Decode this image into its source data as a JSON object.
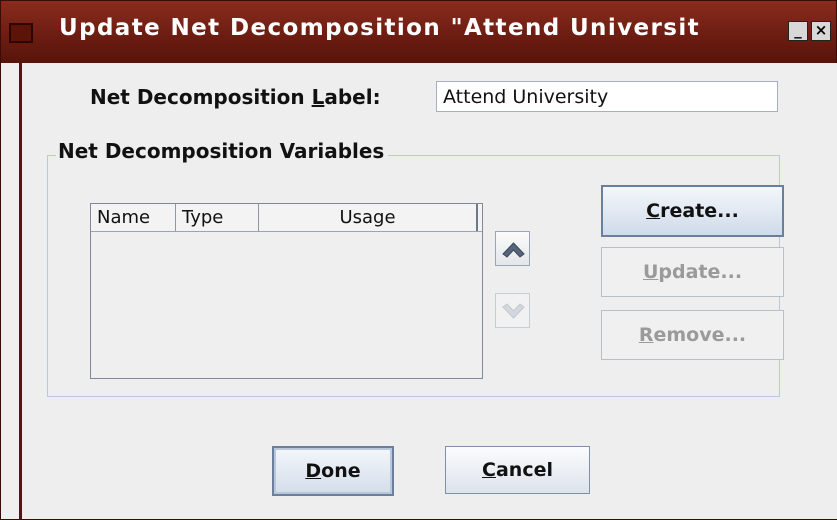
{
  "window": {
    "title": "Update Net Decomposition  \"Attend Universit",
    "minimize_label": "_",
    "close_label": "×"
  },
  "form": {
    "label_mnemonic": "L",
    "label_before": "Net Decomposition ",
    "label_after": "abel:",
    "label_value": "Attend University"
  },
  "variables": {
    "group_title": "Net Decomposition Variables",
    "columns": [
      "Name",
      "Type",
      "Usage"
    ],
    "rows": []
  },
  "side_buttons": {
    "create": {
      "mnemonic": "C",
      "rest": "reate..."
    },
    "update": {
      "mnemonic": "U",
      "rest": "pdate..."
    },
    "remove": {
      "mnemonic": "R",
      "rest": "emove..."
    }
  },
  "footer": {
    "done": {
      "mnemonic": "D",
      "rest": "one"
    },
    "cancel": {
      "mnemonic": "C",
      "rest": "ancel"
    }
  },
  "colors": {
    "titlebar": "#6d1d12",
    "button_accent": "#cfdbea"
  },
  "icons": {
    "up": "chevron-up-icon",
    "down": "chevron-down-icon"
  }
}
